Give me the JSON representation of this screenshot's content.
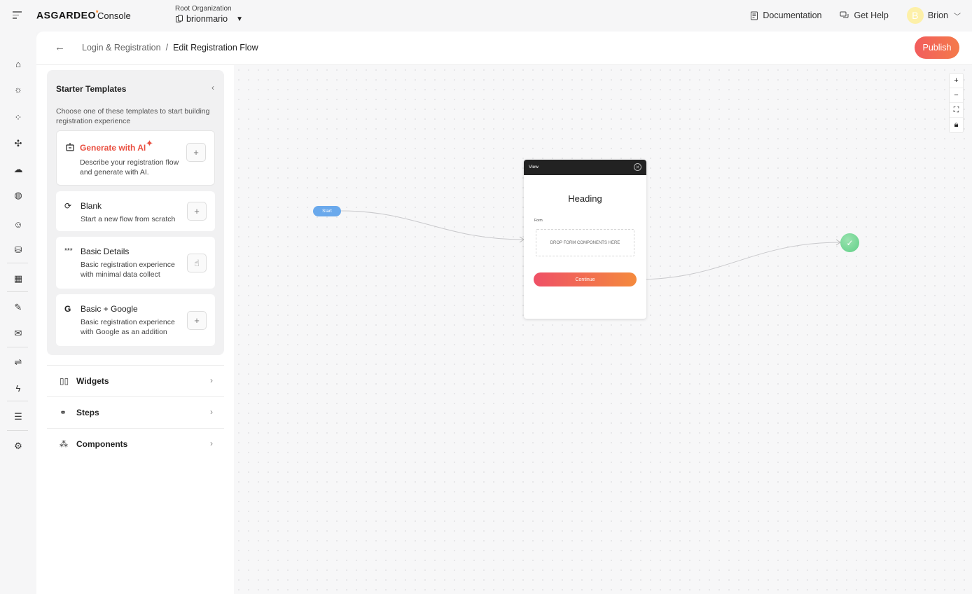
{
  "header": {
    "logo": "ASGARDEO",
    "console": "Console",
    "org_label": "Root Organization",
    "org_name": "brionmario",
    "documentation": "Documentation",
    "get_help": "Get Help",
    "user_initial": "B",
    "user_name": "Brion"
  },
  "breadcrumb": {
    "parent": "Login & Registration",
    "separator": "/",
    "current": "Edit Registration Flow"
  },
  "toolbar": {
    "publish_label": "Publish"
  },
  "rail_icons": [
    "home-icon",
    "bulb-icon",
    "apps-icon",
    "connections-icon",
    "cloud-icon",
    "palette-icon",
    "user-icon",
    "database-icon",
    "organization-icon",
    "signature-icon",
    "email-settings-icon",
    "flow-icon",
    "lightning-icon",
    "logs-icon",
    "settings-icon"
  ],
  "starter": {
    "title": "Starter Templates",
    "description": "Choose one of these templates to start building registration experience",
    "cards": [
      {
        "name": "Generate with AI",
        "icon": "ai-robot-icon",
        "desc": "Describe your registration flow and generate with AI."
      },
      {
        "name": "Blank",
        "icon": "refresh-icon",
        "desc": "Start a new flow from scratch"
      },
      {
        "name": "Basic Details",
        "icon": "password-icon",
        "desc": "Basic registration experience with minimal data collect"
      },
      {
        "name": "Basic + Google",
        "icon": "google-icon",
        "desc": "Basic registration experience with Google as an addition"
      }
    ]
  },
  "sections": [
    {
      "label": "Widgets",
      "icon": "widgets-icon"
    },
    {
      "label": "Steps",
      "icon": "steps-icon"
    },
    {
      "label": "Components",
      "icon": "components-icon"
    }
  ],
  "canvas": {
    "start_label": "Start",
    "view_title": "View",
    "heading": "Heading",
    "form_label": "Form",
    "drop_text": "DROP FORM COMPONENTS HERE",
    "continue_label": "Continue"
  },
  "colors": {
    "accent": "#f25d5d",
    "start_node": "#6aa9ec",
    "end_node": "#5fcf86"
  }
}
